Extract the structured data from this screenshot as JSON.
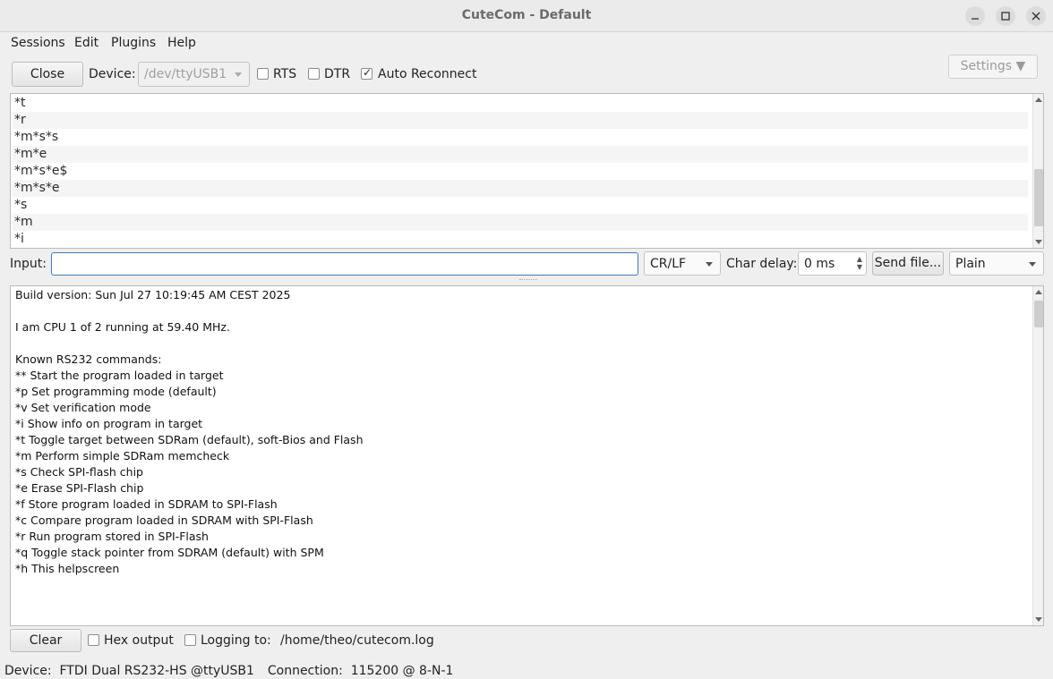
{
  "window": {
    "title": "CuteCom - Default"
  },
  "menu": {
    "items": [
      "Sessions",
      "Edit",
      "Plugins",
      "Help"
    ]
  },
  "toolbar": {
    "close_label": "Close",
    "device_label": "Device:",
    "device_value": "/dev/ttyUSB1",
    "rts_label": "RTS",
    "rts_checked": false,
    "dtr_label": "DTR",
    "dtr_checked": false,
    "auto_reconnect_label": "Auto Reconnect",
    "auto_reconnect_checked": true,
    "settings_label": "Settings ▼"
  },
  "history": {
    "lines": [
      "*t",
      "*r",
      "*m*s*s",
      "*m*e",
      "*m*s*e$",
      "*m*s*e",
      "*s",
      "*m",
      "*i"
    ]
  },
  "input_row": {
    "input_label": "Input:",
    "input_value": "",
    "line_end": "CR/LF",
    "char_delay_label": "Char delay:",
    "char_delay_value": "0 ms",
    "send_file_label": "Send file...",
    "format_value": "Plain"
  },
  "output": {
    "lines": [
      "Build version: Sun Jul 27 10:19:45 AM CEST 2025",
      "",
      "I am CPU 1 of 2 running at 59.40 MHz.",
      "",
      "Known RS232 commands:",
      "** Start the program loaded in target",
      "*p Set programming mode (default)",
      "*v Set verification mode",
      "*i Show info on program in target",
      "*t Toggle target between SDRam (default), soft-Bios and Flash",
      "*m Perform simple SDRam memcheck",
      "*s Check SPI-flash chip",
      "*e Erase SPI-Flash chip",
      "*f Store program loaded in SDRAM to SPI-Flash",
      "*c Compare program loaded in SDRAM with SPI-Flash",
      "*r Run program stored in SPI-Flash",
      "*q Toggle stack pointer from SDRAM (default) with SPM",
      "*h This helpscreen"
    ]
  },
  "bottom": {
    "clear_label": "Clear",
    "hex_output_label": "Hex output",
    "hex_output_checked": false,
    "logging_label": "Logging to:",
    "logging_checked": false,
    "log_path": "/home/theo/cutecom.log"
  },
  "status": {
    "device_text": "Device:  FTDI Dual RS232-HS @ttyUSB1",
    "connection_text": "Connection:  115200 @ 8-N-1"
  }
}
